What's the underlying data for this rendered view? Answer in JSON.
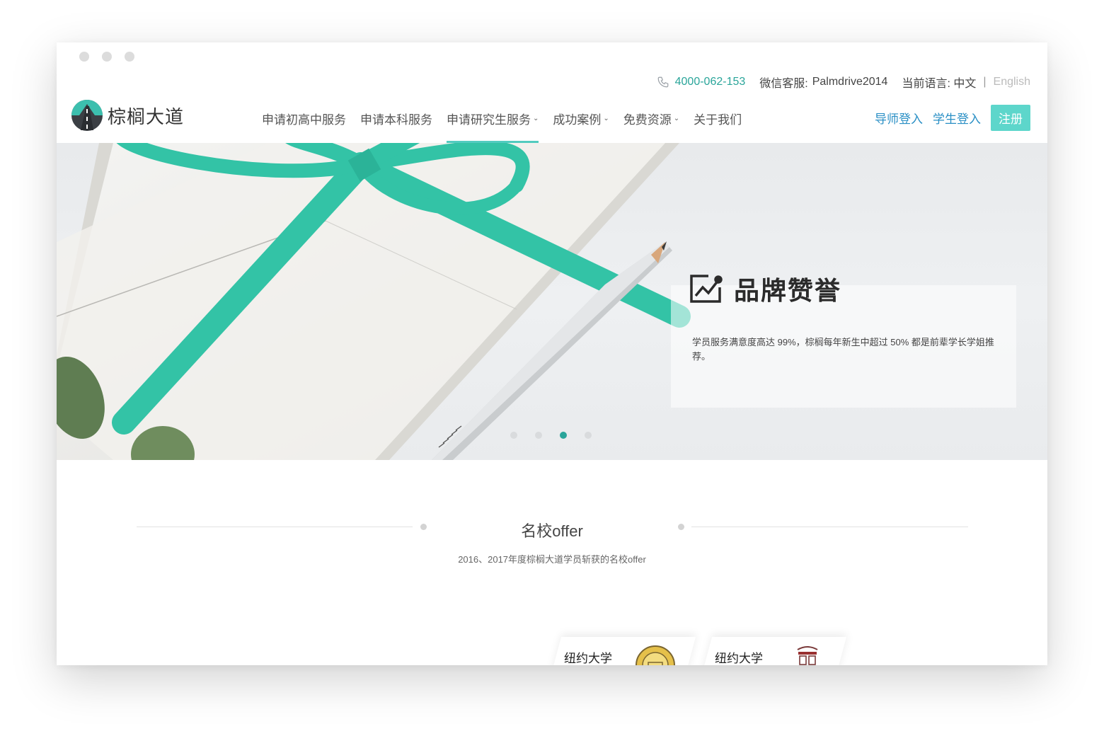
{
  "window": {
    "controls": [
      "close",
      "minimize",
      "maximize"
    ]
  },
  "topbar": {
    "phone": "4000-062-153",
    "wechat_label": "微信客服:",
    "wechat_id": "Palmdrive2014",
    "language_label": "当前语言: 中文",
    "separator": "|",
    "language_alt": "English"
  },
  "brand": {
    "name": "棕榈大道"
  },
  "nav": {
    "items": [
      {
        "label": "申请初高中服务"
      },
      {
        "label": "申请本科服务"
      },
      {
        "label": "申请研究生服务",
        "caret": "⌄"
      },
      {
        "label": "成功案例",
        "caret": "⌄"
      },
      {
        "label": "免费资源",
        "caret": "⌄"
      },
      {
        "label": "关于我们"
      }
    ],
    "active_index": 2
  },
  "auth": {
    "mentor_login": "导师登入",
    "student_login": "学生登入",
    "register": "注册"
  },
  "hero": {
    "title": "品牌赞誉",
    "icon": "trend-chart-icon",
    "description": "学员服务满意度高达 99%，棕榈每年新生中超过 50% 都是前辈学长学姐推荐。",
    "slides": 4,
    "active_slide": 3
  },
  "offers": {
    "title": "名校offer",
    "subtitle": "2016、2017年度棕榈大道学员斩获的名校offer",
    "cards": [
      {
        "name": "纽约大学",
        "seal": "gold-seal-icon"
      },
      {
        "name": "纽约大学",
        "seal": "red-crest-icon"
      }
    ]
  },
  "colors": {
    "accent": "#52cbbf",
    "teal_text": "#2aa59a",
    "link_blue": "#2a8fc5",
    "ribbon": "#36c4a8"
  }
}
